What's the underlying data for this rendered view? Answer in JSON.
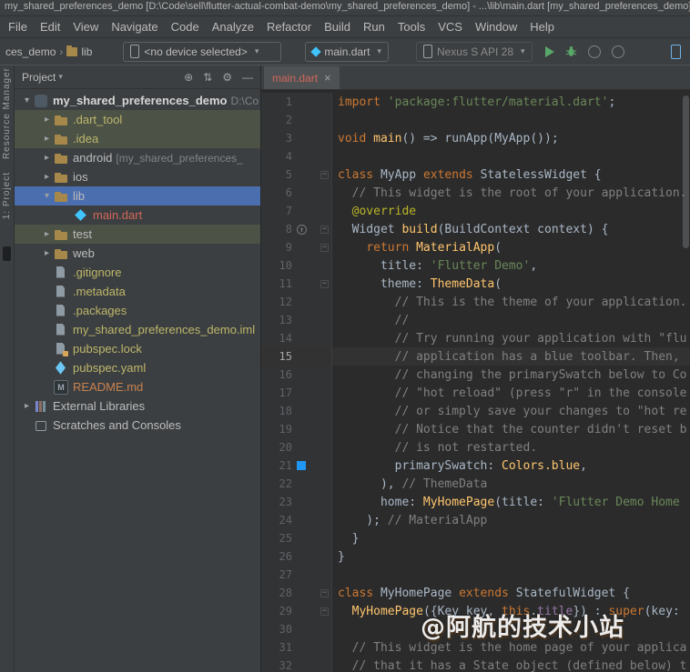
{
  "window": {
    "title": "my_shared_preferences_demo [D:\\Code\\sell\\flutter-actual-combat-demo\\my_shared_preferences_demo] - ...\\lib\\main.dart [my_shared_preferences_demo]"
  },
  "menu": [
    "File",
    "Edit",
    "View",
    "Navigate",
    "Code",
    "Analyze",
    "Refactor",
    "Build",
    "Run",
    "Tools",
    "VCS",
    "Window",
    "Help"
  ],
  "toolbar": {
    "breadcrumb_project": "ces_demo",
    "breadcrumb_folder": "lib",
    "device_selector": "<no device selected>",
    "run_config": "main.dart",
    "avd_selector": "Nexus S API 28"
  },
  "tool_strip": {
    "top_label": "Resource Manager",
    "bottom_label": "1: Project"
  },
  "icons": {
    "breadcrumb_separator": "›",
    "dropdown_arrow": "▾",
    "tree_collapsed": "▸",
    "tree_expanded": "▾",
    "close": "×",
    "fold": "−",
    "override": "↑",
    "locate": "⊕",
    "swap": "⇅",
    "settings": "⚙",
    "hide": "—"
  },
  "colors": {
    "selection": "#4b6eaf",
    "current_line": "#323232",
    "color_swatch": "#2196F3",
    "keyword": "#cc7832",
    "string": "#6a8759",
    "comment": "#808080",
    "annotation": "#bbb529",
    "call": "#ffc66e",
    "member": "#9876aa",
    "error_file": "#d1675a",
    "ignored_file": "#bdb76b"
  },
  "project_panel": {
    "title": "Project",
    "tree": [
      {
        "label": "my_shared_preferences_demo",
        "suffix": " D:\\Co",
        "depth": 0,
        "arrow": "down",
        "icon": "project",
        "color": "root"
      },
      {
        "label": ".dart_tool",
        "depth": 1,
        "arrow": "right",
        "icon": "folder",
        "color": "gold",
        "band": true
      },
      {
        "label": ".idea",
        "depth": 1,
        "arrow": "right",
        "icon": "folder",
        "color": "gold",
        "band": true
      },
      {
        "label": "android",
        "suffix": " [my_shared_preferences_",
        "depth": 1,
        "arrow": "right",
        "icon": "folder",
        "color": "default"
      },
      {
        "label": "ios",
        "depth": 1,
        "arrow": "right",
        "icon": "folder",
        "color": "default"
      },
      {
        "label": "lib",
        "depth": 1,
        "arrow": "down",
        "icon": "folder",
        "color": "default",
        "selected": true
      },
      {
        "label": "main.dart",
        "depth": 2,
        "icon": "dart",
        "color": "red"
      },
      {
        "label": "test",
        "depth": 1,
        "arrow": "right",
        "icon": "folder",
        "color": "default",
        "band": true
      },
      {
        "label": "web",
        "depth": 1,
        "arrow": "right",
        "icon": "folder",
        "color": "default"
      },
      {
        "label": ".gitignore",
        "depth": 1,
        "icon": "file",
        "color": "gold"
      },
      {
        "label": ".metadata",
        "depth": 1,
        "icon": "file",
        "color": "gold"
      },
      {
        "label": ".packages",
        "depth": 1,
        "icon": "file",
        "color": "gold"
      },
      {
        "label": "my_shared_preferences_demo.iml",
        "depth": 1,
        "icon": "file",
        "color": "gold"
      },
      {
        "label": "pubspec.lock",
        "depth": 1,
        "icon": "lock",
        "color": "gold"
      },
      {
        "label": "pubspec.yaml",
        "depth": 1,
        "icon": "flutter",
        "color": "gold"
      },
      {
        "label": "README.md",
        "depth": 1,
        "icon": "md",
        "color": "orange"
      },
      {
        "label": "External Libraries",
        "depth": 0,
        "arrow": "right",
        "icon": "books",
        "color": "default"
      },
      {
        "label": "Scratches and Consoles",
        "depth": 0,
        "icon": "scratch",
        "color": "default"
      }
    ]
  },
  "editor": {
    "tab_label": "main.dart",
    "current_line": 15,
    "override_line": 8,
    "color_swatch_line": 21,
    "fold_lines": [
      5,
      8,
      9,
      11,
      28,
      29
    ],
    "lines": [
      [
        [
          "kw",
          "import "
        ],
        [
          "str",
          "'package:flutter/material.dart'"
        ],
        [
          "pl",
          ";"
        ]
      ],
      [],
      [
        [
          "kw",
          "void "
        ],
        [
          "fn",
          "main"
        ],
        [
          "pl",
          "() => runApp(MyApp());"
        ]
      ],
      [],
      [
        [
          "kw",
          "class "
        ],
        [
          "pl",
          "MyApp "
        ],
        [
          "kw",
          "extends "
        ],
        [
          "pl",
          "StatelessWidget {"
        ]
      ],
      [
        [
          "cm",
          "  // This widget is the root of your application."
        ]
      ],
      [
        [
          "pl",
          "  "
        ],
        [
          "ann",
          "@override"
        ]
      ],
      [
        [
          "pl",
          "  Widget "
        ],
        [
          "fn",
          "build"
        ],
        [
          "pl",
          "(BuildContext context) {"
        ]
      ],
      [
        [
          "pl",
          "    "
        ],
        [
          "kw",
          "return "
        ],
        [
          "fn",
          "MaterialApp"
        ],
        [
          "pl",
          "("
        ]
      ],
      [
        [
          "pl",
          "      title: "
        ],
        [
          "str",
          "'Flutter Demo'"
        ],
        [
          "pl",
          ","
        ]
      ],
      [
        [
          "pl",
          "      theme: "
        ],
        [
          "fn",
          "ThemeData"
        ],
        [
          "pl",
          "("
        ]
      ],
      [
        [
          "cm",
          "        // This is the theme of your application."
        ]
      ],
      [
        [
          "cm",
          "        //"
        ]
      ],
      [
        [
          "cm",
          "        // Try running your application with \"flu"
        ]
      ],
      [
        [
          "cm",
          "        // application has a blue toolbar. Then, "
        ]
      ],
      [
        [
          "cm",
          "        // changing the primarySwatch below to Co"
        ]
      ],
      [
        [
          "cm",
          "        // \"hot reload\" (press \"r\" in the console"
        ]
      ],
      [
        [
          "cm",
          "        // or simply save your changes to \"hot re"
        ]
      ],
      [
        [
          "cm",
          "        // Notice that the counter didn't reset b"
        ]
      ],
      [
        [
          "cm",
          "        // is not restarted."
        ]
      ],
      [
        [
          "pl",
          "        primarySwatch: "
        ],
        [
          "fn",
          "Colors.blue"
        ],
        [
          "pl",
          ","
        ]
      ],
      [
        [
          "pl",
          "      ), "
        ],
        [
          "cm",
          "// ThemeData"
        ]
      ],
      [
        [
          "pl",
          "      home: "
        ],
        [
          "fn",
          "MyHomePage"
        ],
        [
          "pl",
          "(title: "
        ],
        [
          "str",
          "'Flutter Demo Home"
        ]
      ],
      [
        [
          "pl",
          "    ); "
        ],
        [
          "cm",
          "// MaterialApp"
        ]
      ],
      [
        [
          "pl",
          "  }"
        ]
      ],
      [
        [
          "pl",
          "}"
        ]
      ],
      [],
      [
        [
          "kw",
          "class "
        ],
        [
          "pl",
          "MyHomePage "
        ],
        [
          "kw",
          "extends "
        ],
        [
          "pl",
          "StatefulWidget {"
        ]
      ],
      [
        [
          "pl",
          "  "
        ],
        [
          "fn",
          "MyHomePage"
        ],
        [
          "pl",
          "({Key key, "
        ],
        [
          "kw",
          "this"
        ],
        [
          "pl",
          "."
        ],
        [
          "fld",
          "title"
        ],
        [
          "pl",
          "}) : "
        ],
        [
          "kw",
          "super"
        ],
        [
          "pl",
          "(key:"
        ]
      ],
      [],
      [
        [
          "cm",
          "  // This widget is the home page of your applica"
        ]
      ],
      [
        [
          "cm",
          "  // that it has a State object (defined below) t"
        ]
      ]
    ]
  },
  "watermark": "@阿航的技术小站"
}
